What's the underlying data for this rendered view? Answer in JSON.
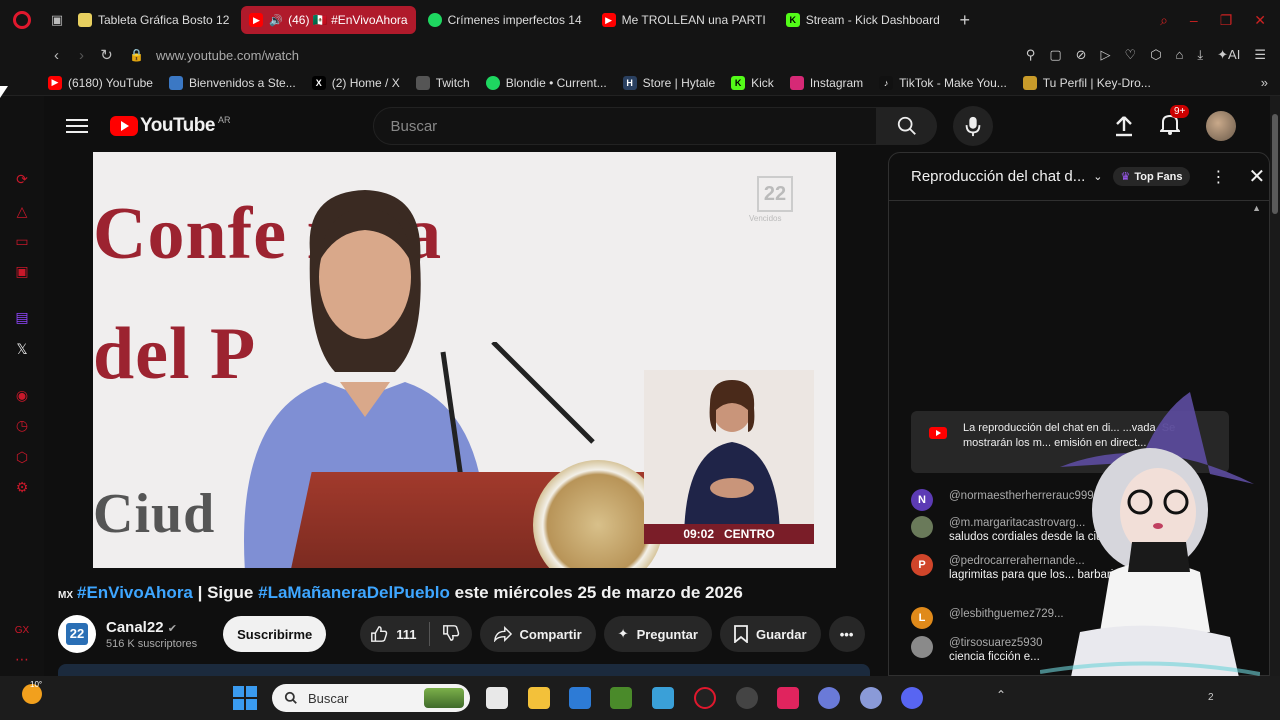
{
  "browser": {
    "tabs": [
      {
        "label": "Tableta Gráfica Bosto 12",
        "fav_color": "#e8d060",
        "active": false
      },
      {
        "label": "(46) 🇲🇽 #EnVivoAhora",
        "fav_color": "#ff0000",
        "active": true
      },
      {
        "label": "Crímenes imperfectos 14",
        "fav_color": "#1ed760",
        "active": false
      },
      {
        "label": "Me TROLLEAN una PARTI",
        "fav_color": "#ff0000",
        "active": false
      },
      {
        "label": "Stream - Kick Dashboard",
        "fav_color": "#53fc18",
        "active": false
      }
    ],
    "url": "www.youtube.com/watch",
    "bookmarks": [
      {
        "label": "(6180) YouTube",
        "fav_color": "#ff0000"
      },
      {
        "label": "Bienvenidos a Ste...",
        "fav_color": "#3b78c4"
      },
      {
        "label": "(2) Home / X",
        "fav_color": "#000000",
        "glyph": "X"
      },
      {
        "label": "Twitch",
        "fav_color": "#555555"
      },
      {
        "label": "Blondie • Current...",
        "fav_color": "#1ed760"
      },
      {
        "label": "Store | Hytale",
        "fav_color": "#2a4060"
      },
      {
        "label": "Kick",
        "fav_color": "#53fc18"
      },
      {
        "label": "Instagram",
        "fav_color": "#d62976"
      },
      {
        "label": "TikTok - Make You...",
        "fav_color": "#111111"
      },
      {
        "label": "Tu Perfil | Key-Dro...",
        "fav_color": "#c89b2a"
      }
    ]
  },
  "youtube": {
    "logo_text": "YouTube",
    "region": "AR",
    "search_placeholder": "Buscar",
    "notif_count": "9+"
  },
  "video": {
    "overlay_line1": "Confe  ncia",
    "overlay_line2": "del P",
    "overlay_line3": "Ciud",
    "corner_logo": "22",
    "corner_logo_sub": "Vencidos",
    "signer_time": "09:02",
    "signer_zone": "CENTRO",
    "title_flag": "MX",
    "title_tag1": "#EnVivoAhora",
    "title_sep": " | Sigue ",
    "title_tag2": "#LaMañaneraDelPueblo",
    "title_rest": " este miércoles 25 de marzo de 2026",
    "channel_name": "Canal22",
    "channel_avatar_text": "22",
    "subscribers": "516 K suscriptores",
    "subscribe_label": "Suscribirme",
    "likes": "111",
    "share_label": "Compartir",
    "ask_label": "Preguntar",
    "save_label": "Guardar"
  },
  "chat": {
    "title": "Reproducción del chat d...",
    "top_fans": "Top Fans",
    "notice": "La reproducción del chat en di... ...vada. Se mostrarán los m... emisión en direct...",
    "messages": [
      {
        "initial": "N",
        "color": "#5c3bb5",
        "author": "@normaestherherrerauc999",
        "text": ""
      },
      {
        "initial": "",
        "color": "#6a7a5a",
        "author": "@m.margaritacastrovarg...",
        "text": "saludos cordiales desde la ciuda... ...najuato."
      },
      {
        "initial": "P",
        "color": "#d0452a",
        "author": "@pedrocarrerahernande...",
        "text": "lagrimitas para que los... barbarie ....."
      },
      {
        "initial": "L",
        "color": "#e08a1a",
        "author": "@lesbithguemez729...",
        "text": ""
      },
      {
        "initial": "",
        "color": "#8a8a8a",
        "author": "@tirsosuarez5930",
        "text": "ciencia ficción e..."
      }
    ]
  },
  "taskbar": {
    "temperature": "10°",
    "search_label": "Buscar",
    "tray_number": "2"
  },
  "colors": {
    "accent_red": "#ff0000",
    "opera_red": "#c8182a",
    "link_blue": "#3ea6ff"
  }
}
